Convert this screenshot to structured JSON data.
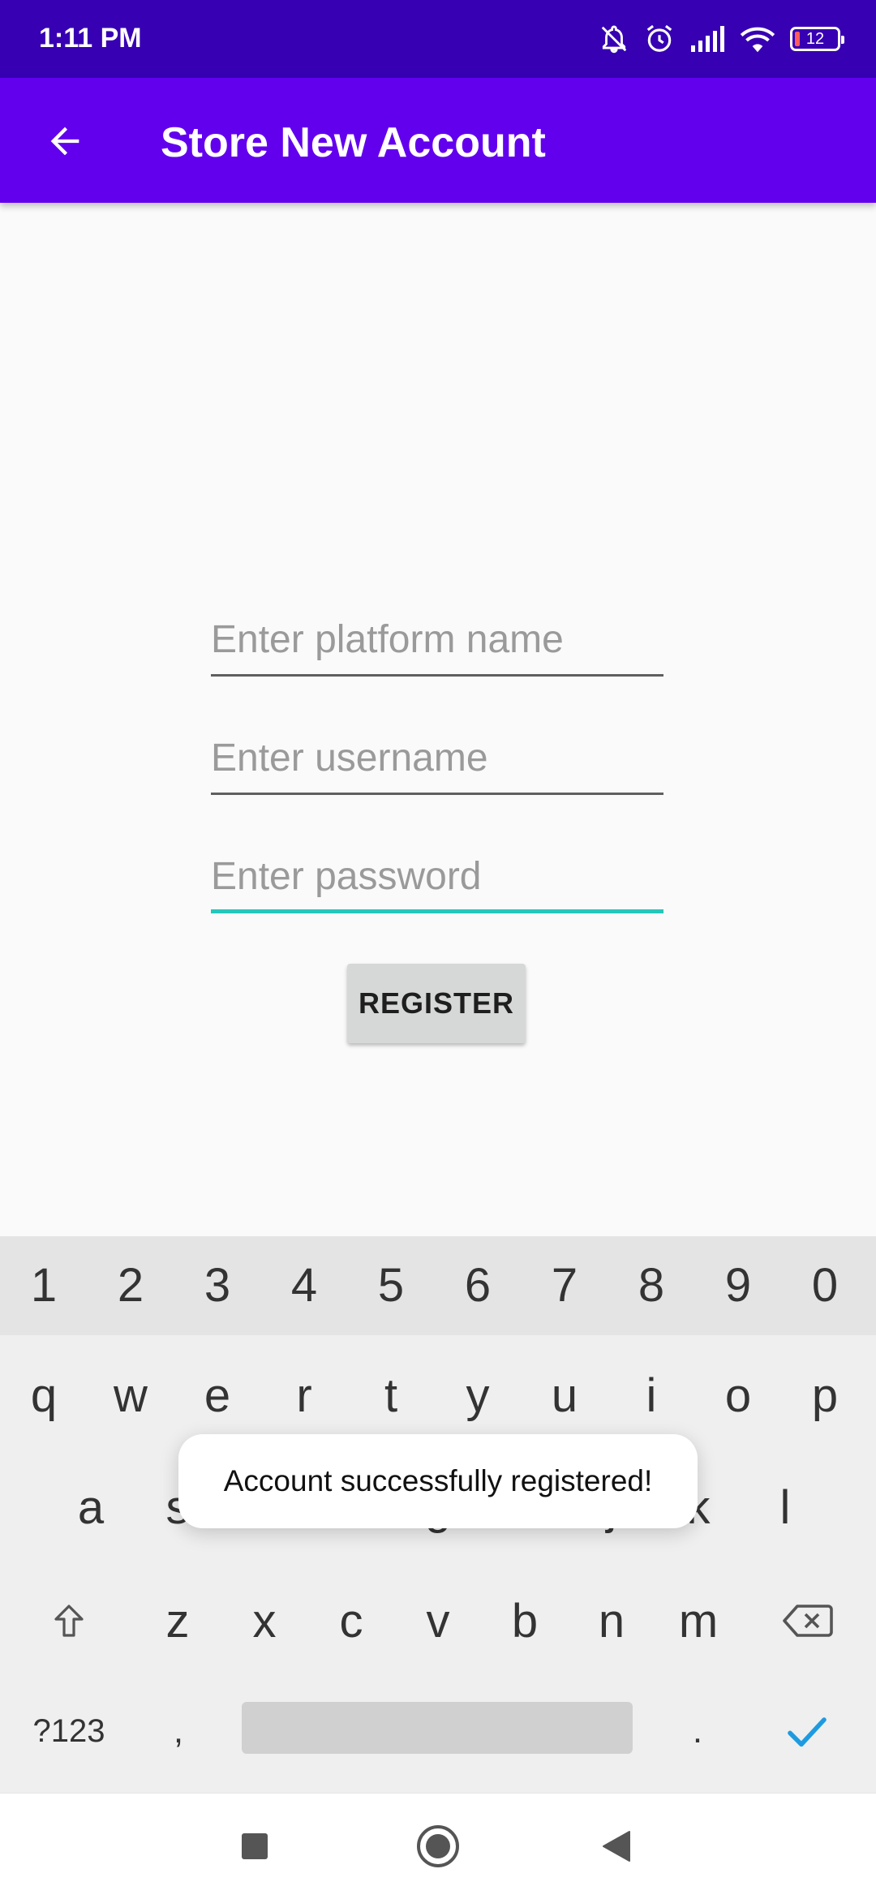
{
  "status_bar": {
    "time": "1:11 PM",
    "battery_level": "12",
    "icons": [
      "notifications-off-icon",
      "alarm-icon",
      "signal-icon",
      "wifi-icon",
      "battery-icon"
    ]
  },
  "app_bar": {
    "title": "Store New Account",
    "back_icon": "arrow-back-icon"
  },
  "form": {
    "platform_placeholder": "Enter platform name",
    "username_placeholder": "Enter username",
    "password_placeholder": "Enter password",
    "platform_value": "",
    "username_value": "",
    "password_value": "",
    "focused_field": "password",
    "register_label": "REGISTER"
  },
  "keyboard": {
    "number_row": [
      "1",
      "2",
      "3",
      "4",
      "5",
      "6",
      "7",
      "8",
      "9",
      "0"
    ],
    "row1": [
      "q",
      "w",
      "e",
      "r",
      "t",
      "y",
      "u",
      "i",
      "o",
      "p"
    ],
    "row2": [
      "a",
      "s",
      "d",
      "f",
      "g",
      "h",
      "j",
      "k",
      "l"
    ],
    "row3": [
      "z",
      "x",
      "c",
      "v",
      "b",
      "n",
      "m"
    ],
    "symbols_label": "?123",
    "comma": ",",
    "period": ".",
    "shift_icon": "shift-arrow-icon",
    "backspace_icon": "backspace-icon",
    "done_icon": "check-icon"
  },
  "toast": {
    "message": "Account successfully registered!"
  },
  "nav_bar": {
    "icons": [
      "recents-square-icon",
      "home-circle-icon",
      "back-triangle-icon"
    ]
  },
  "colors": {
    "status_bar": "#3700b3",
    "app_bar": "#6200ee",
    "focus_accent": "#26c6bb",
    "done_check": "#1e9be0"
  }
}
